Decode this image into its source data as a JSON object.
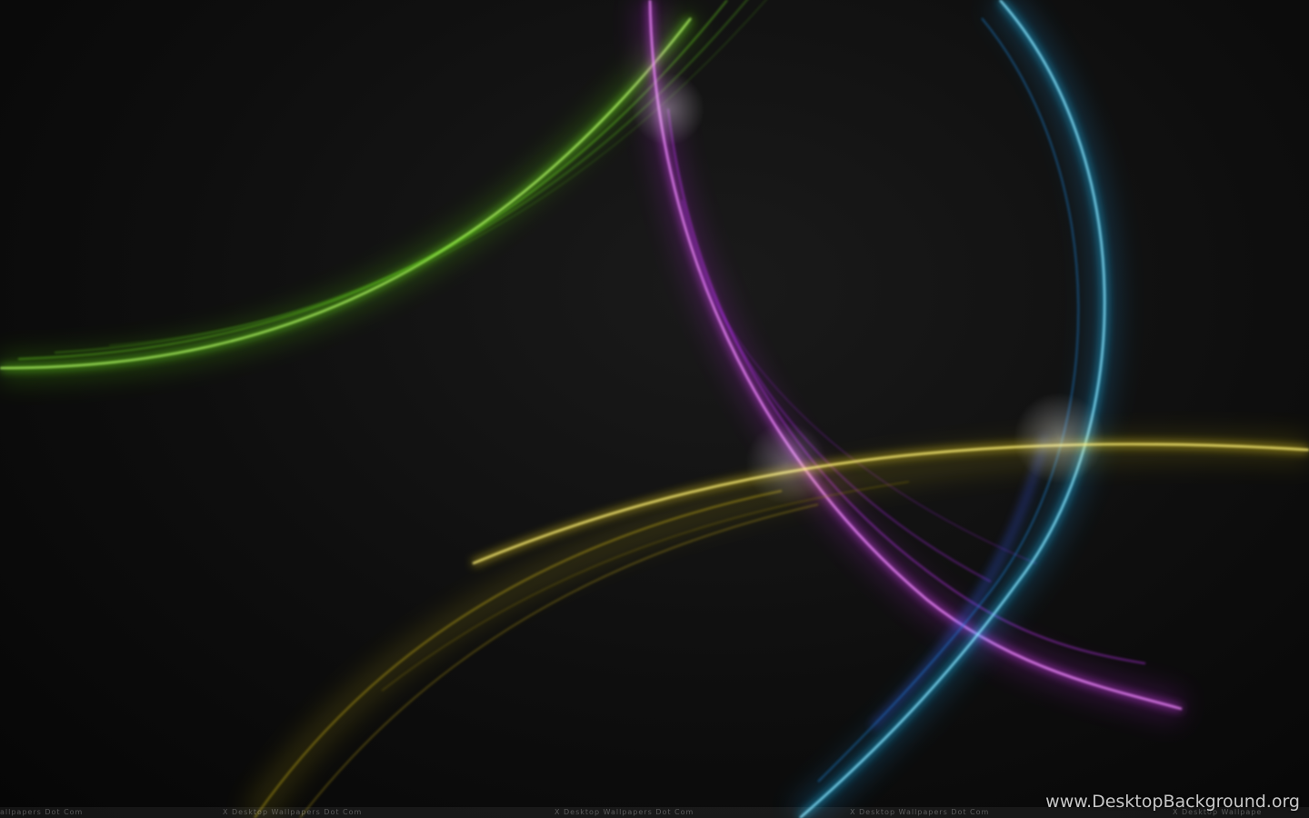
{
  "image": {
    "background_color": "#0b0b0b",
    "streaks": [
      {
        "name": "green",
        "color": "#7cff1a"
      },
      {
        "name": "magenta",
        "color": "#e040ff"
      },
      {
        "name": "blue",
        "color": "#1ec8ff"
      },
      {
        "name": "yellow",
        "color": "#ffe31a"
      }
    ]
  },
  "watermark": {
    "strip_texts": [
      "allpapers Dot Com",
      "X Desktop Wallpapers Dot Com",
      "X Desktop Wallpapers Dot Com",
      "X Desktop Wallpapers Dot Com",
      "X Desktop Wallpape"
    ],
    "site_credit": "www.DesktopBackground.org"
  }
}
